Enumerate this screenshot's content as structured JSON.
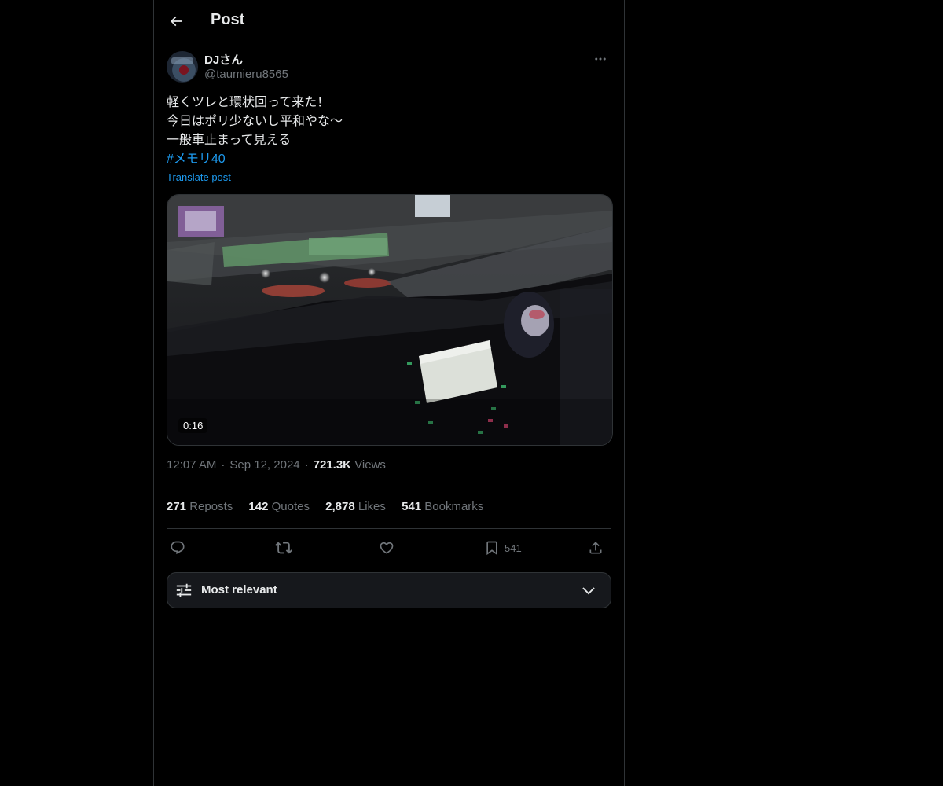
{
  "header": {
    "title": "Post"
  },
  "author": {
    "display_name": "DJさん",
    "handle": "@taumieru8565"
  },
  "post": {
    "lines": [
      "軽くツレと環状回って来た！",
      "今日はポリ少ないし平和やな〜",
      "一般車止まって見える"
    ],
    "hashtag": "#メモリ40",
    "translate_label": "Translate post"
  },
  "media": {
    "duration": "0:16"
  },
  "meta": {
    "time": "12:07 AM",
    "date": "Sep 12, 2024",
    "views_count": "721.3K",
    "views_label": "Views"
  },
  "stats": [
    {
      "count": "271",
      "label": "Reposts"
    },
    {
      "count": "142",
      "label": "Quotes"
    },
    {
      "count": "2,878",
      "label": "Likes"
    },
    {
      "count": "541",
      "label": "Bookmarks"
    }
  ],
  "actions": {
    "bookmark_count": "541"
  },
  "sort": {
    "label": "Most relevant"
  },
  "colors": {
    "accent": "#1d9bf0",
    "secondary_text": "#71767b",
    "border": "#2f3336",
    "background": "#000000"
  }
}
